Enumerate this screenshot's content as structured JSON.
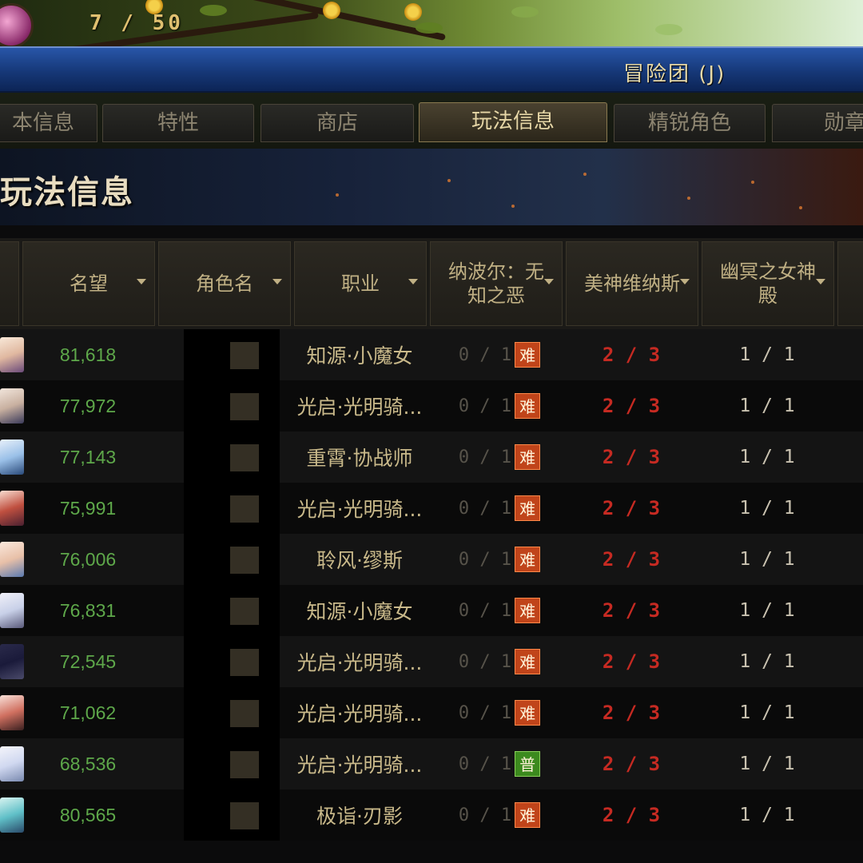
{
  "top_bar": {
    "count": "7 / 50"
  },
  "window": {
    "title": "冒险团 (J)"
  },
  "tabs": [
    {
      "label": "本信息",
      "active": false
    },
    {
      "label": "特性",
      "active": false
    },
    {
      "label": "商店",
      "active": false
    },
    {
      "label": "玩法信息",
      "active": true
    },
    {
      "label": "精锐角色",
      "active": false
    },
    {
      "label": "勋章",
      "active": false
    }
  ],
  "section": {
    "title": "玩法信息"
  },
  "columns": [
    {
      "label": "名望"
    },
    {
      "label": "角色名"
    },
    {
      "label": "职业"
    },
    {
      "label": "纳波尔：无知之恶"
    },
    {
      "label": "美神维纳斯"
    },
    {
      "label": "幽冥之女神殿"
    }
  ],
  "rows": [
    {
      "fame": "81,618",
      "job": "知源·小魔女",
      "nabo": "0 / 1",
      "badge": "难",
      "badge_color": "orange",
      "venus": "2 / 3",
      "styx": "1 / 1"
    },
    {
      "fame": "77,972",
      "job": "光启·光明骑...",
      "nabo": "0 / 1",
      "badge": "难",
      "badge_color": "orange",
      "venus": "2 / 3",
      "styx": "1 / 1"
    },
    {
      "fame": "77,143",
      "job": "重霄·协战师",
      "nabo": "0 / 1",
      "badge": "难",
      "badge_color": "orange",
      "venus": "2 / 3",
      "styx": "1 / 1"
    },
    {
      "fame": "75,991",
      "job": "光启·光明骑...",
      "nabo": "0 / 1",
      "badge": "难",
      "badge_color": "orange",
      "venus": "2 / 3",
      "styx": "1 / 1"
    },
    {
      "fame": "76,006",
      "job": "聆风·缪斯",
      "nabo": "0 / 1",
      "badge": "难",
      "badge_color": "orange",
      "venus": "2 / 3",
      "styx": "1 / 1"
    },
    {
      "fame": "76,831",
      "job": "知源·小魔女",
      "nabo": "0 / 1",
      "badge": "难",
      "badge_color": "orange",
      "venus": "2 / 3",
      "styx": "1 / 1"
    },
    {
      "fame": "72,545",
      "job": "光启·光明骑...",
      "nabo": "0 / 1",
      "badge": "难",
      "badge_color": "orange",
      "venus": "2 / 3",
      "styx": "1 / 1"
    },
    {
      "fame": "71,062",
      "job": "光启·光明骑...",
      "nabo": "0 / 1",
      "badge": "难",
      "badge_color": "orange",
      "venus": "2 / 3",
      "styx": "1 / 1"
    },
    {
      "fame": "68,536",
      "job": "光启·光明骑...",
      "nabo": "0 / 1",
      "badge": "普",
      "badge_color": "green",
      "venus": "2 / 3",
      "styx": "1 / 1"
    },
    {
      "fame": "80,565",
      "job": "极诣·刃影",
      "nabo": "0 / 1",
      "badge": "难",
      "badge_color": "orange",
      "venus": "2 / 3",
      "styx": "1 / 1"
    }
  ]
}
